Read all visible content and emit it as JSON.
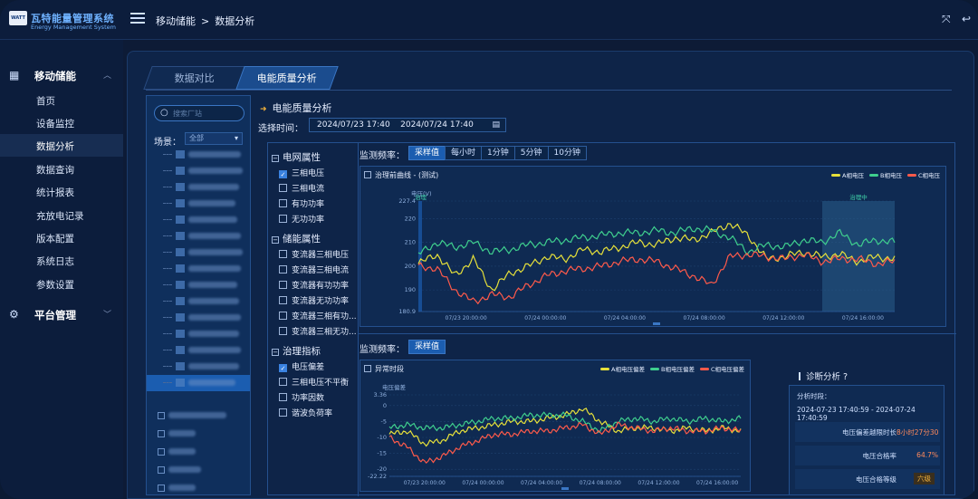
{
  "app": {
    "logo_text": "WATT",
    "title": "瓦特能量管理系统",
    "subtitle": "Energy Management System"
  },
  "breadcrumb": {
    "parent": "移动储能",
    "separator": ">",
    "current": "数据分析"
  },
  "sidebar": {
    "group1": {
      "label": "移动储能",
      "icon": "storage-icon"
    },
    "items": [
      {
        "label": "首页"
      },
      {
        "label": "设备监控"
      },
      {
        "label": "数据分析",
        "active": true
      },
      {
        "label": "数据查询"
      },
      {
        "label": "统计报表"
      },
      {
        "label": "充放电记录"
      },
      {
        "label": "版本配置"
      },
      {
        "label": "系统日志"
      },
      {
        "label": "参数设置"
      }
    ],
    "group2": {
      "label": "平台管理",
      "icon": "gear-icon"
    }
  },
  "tabs": [
    {
      "label": "数据对比",
      "active": false
    },
    {
      "label": "电能质量分析",
      "active": true
    }
  ],
  "tree": {
    "search_placeholder": "搜索厂站",
    "scene_label": "场景：",
    "scene_value": "全部"
  },
  "section": {
    "title": "电能质量分析",
    "time_label": "选择时间：",
    "time_start": "2024/07/23 17:40",
    "time_end": "2024/07/24 17:40"
  },
  "grid_attrs": {
    "title": "电网属性",
    "items": [
      {
        "label": "三相电压",
        "checked": true
      },
      {
        "label": "三相电流",
        "checked": false
      },
      {
        "label": "有功功率",
        "checked": false
      },
      {
        "label": "无功功率",
        "checked": false
      }
    ]
  },
  "storage_attrs": {
    "title": "储能属性",
    "items": [
      {
        "label": "变流器三相电压",
        "checked": false
      },
      {
        "label": "变流器三相电流",
        "checked": false
      },
      {
        "label": "变流器有功功率",
        "checked": false
      },
      {
        "label": "变流器无功功率",
        "checked": false
      },
      {
        "label": "变流器三相有功...",
        "checked": false
      },
      {
        "label": "变流器三相无功...",
        "checked": false
      }
    ]
  },
  "gov_attrs": {
    "title": "治理指标",
    "items": [
      {
        "label": "电压偏差",
        "checked": true
      },
      {
        "label": "三相电压不平衡",
        "checked": false
      },
      {
        "label": "功率因数",
        "checked": false
      },
      {
        "label": "谐波负荷率",
        "checked": false
      }
    ]
  },
  "freq_top": {
    "label": "监测频率：",
    "options": [
      "采样值",
      "每小时",
      "1分钟",
      "5分钟",
      "10分钟"
    ],
    "selected": "采样值"
  },
  "freq_bottom": {
    "label": "监测频率：",
    "options": [
      "采样值"
    ],
    "selected": "采样值"
  },
  "chart_top_head": {
    "label": "治理前曲线 - (测试)",
    "unit": "电压(V)",
    "before_tag": "治理",
    "during_tag": "治理中"
  },
  "chart_bottom_head": {
    "label": "异常时段",
    "unit": "电压偏差"
  },
  "diagnosis": {
    "title": "诊断分析",
    "analysis_label": "分析时段：",
    "analysis_range": "2024-07-23 17:40:59 - 2024-07-24 17:40:59",
    "rows": [
      {
        "key": "电压偏差越限时长",
        "value": "8小时27分30"
      },
      {
        "key": "电压合格率",
        "value": "64.7%"
      },
      {
        "key": "电压合格等级",
        "value": "六级"
      }
    ]
  },
  "colors": {
    "phase_a": "#e6e03a",
    "phase_b": "#3fcf8e",
    "phase_c": "#ff5a4a",
    "accent": "#1b5db0"
  },
  "chart_data": [
    {
      "type": "line",
      "ylabel": "电压(V)",
      "ylim": [
        180.9,
        227.4
      ],
      "yticks": [
        227.4,
        220,
        210,
        200,
        190,
        180.9
      ],
      "x_ticks": [
        "07/23 20:00:00",
        "07/24 00:00:00",
        "07/24 04:00:00",
        "07/24 08:00:00",
        "07/24 12:00:00",
        "07/24 16:00:00"
      ],
      "legend_position": "top-right",
      "series": [
        {
          "name": "A相电压",
          "values": [
            201,
            205,
            196,
            203,
            190,
            197,
            200,
            204,
            203,
            207,
            206,
            208,
            210,
            209,
            212,
            211,
            214,
            218,
            213,
            203,
            204,
            206,
            204,
            205,
            202,
            204,
            203
          ]
        },
        {
          "name": "B相电压",
          "values": [
            205,
            210,
            208,
            210,
            206,
            207,
            209,
            210,
            211,
            212,
            213,
            214,
            214,
            215,
            214,
            216,
            215,
            212,
            206,
            209,
            208,
            211,
            210,
            214,
            209,
            211,
            210
          ]
        },
        {
          "name": "C相电压",
          "values": [
            200,
            199,
            190,
            185,
            188,
            187,
            192,
            196,
            198,
            199,
            200,
            202,
            203,
            202,
            199,
            196,
            192,
            204,
            205,
            204,
            203,
            205,
            202,
            203,
            203,
            201,
            202
          ]
        }
      ]
    },
    {
      "type": "line",
      "ylabel": "电压偏差",
      "ylim": [
        -22.22,
        3.36
      ],
      "yticks": [
        3.36,
        0,
        -5,
        -10,
        -15,
        -20,
        -22.22
      ],
      "x_ticks": [
        "07/23 20:00:00",
        "07/24 00:00:00",
        "07/24 04:00:00",
        "07/24 08:00:00",
        "07/24 12:00:00",
        "07/24 16:00:00"
      ],
      "legend_position": "top-right",
      "series": [
        {
          "name": "A相电压偏差",
          "values": [
            -9,
            -8,
            -12,
            -11,
            -8,
            -7,
            -6,
            -5,
            -5,
            -4,
            -3,
            -1,
            -5,
            -8,
            -7,
            -7,
            -8,
            -7,
            -8,
            -7,
            -8
          ]
        },
        {
          "name": "B相电压偏差",
          "values": [
            -7,
            -6,
            -7,
            -7,
            -6,
            -5,
            -4,
            -4,
            -3,
            -3,
            -3,
            -5,
            -8,
            -5,
            -4,
            -5,
            -4,
            -5,
            -4,
            -5,
            -4
          ]
        },
        {
          "name": "C相电压偏差",
          "values": [
            -10,
            -13,
            -18,
            -16,
            -13,
            -11,
            -9,
            -9,
            -8,
            -8,
            -7,
            -6,
            -9,
            -6,
            -7,
            -8,
            -7,
            -8,
            -8,
            -7,
            -8
          ]
        }
      ]
    }
  ]
}
